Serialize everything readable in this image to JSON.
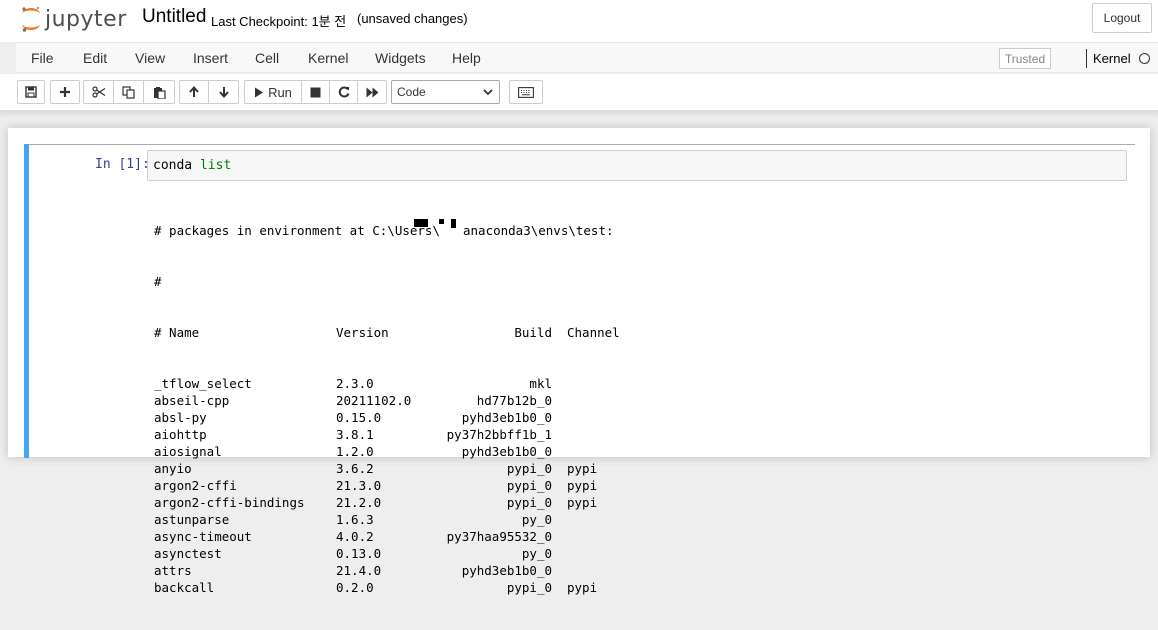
{
  "header": {
    "logo_text": "jupyter",
    "notebook_name": "Untitled",
    "checkpoint": "Last Checkpoint: 1분 전",
    "unsaved": "(unsaved changes)",
    "logout_label": "Logout"
  },
  "menubar": {
    "items": [
      "File",
      "Edit",
      "View",
      "Insert",
      "Cell",
      "Kernel",
      "Widgets",
      "Help"
    ],
    "trusted_label": "Trusted",
    "kernel_label": "Kernel"
  },
  "toolbar": {
    "run_label": "Run",
    "cell_type": "Code"
  },
  "cell": {
    "prompt": "In [1]:",
    "code_cmd": "conda",
    "code_arg": "list",
    "output_header": [
      "# packages in environment at C:\\Users\\",
      "#",
      "# Name"
    ],
    "env_path_suffix": "anaconda3\\envs\\test:",
    "columns": {
      "version": "Version",
      "build": "Build",
      "channel": "Channel"
    },
    "packages": [
      {
        "name": "_tflow_select",
        "version": "2.3.0",
        "build": "mkl",
        "channel": ""
      },
      {
        "name": "abseil-cpp",
        "version": "20211102.0",
        "build": "hd77b12b_0",
        "channel": ""
      },
      {
        "name": "absl-py",
        "version": "0.15.0",
        "build": "pyhd3eb1b0_0",
        "channel": ""
      },
      {
        "name": "aiohttp",
        "version": "3.8.1",
        "build": "py37h2bbff1b_1",
        "channel": ""
      },
      {
        "name": "aiosignal",
        "version": "1.2.0",
        "build": "pyhd3eb1b0_0",
        "channel": ""
      },
      {
        "name": "anyio",
        "version": "3.6.2",
        "build": "pypi_0",
        "channel": "pypi"
      },
      {
        "name": "argon2-cffi",
        "version": "21.3.0",
        "build": "pypi_0",
        "channel": "pypi"
      },
      {
        "name": "argon2-cffi-bindings",
        "version": "21.2.0",
        "build": "pypi_0",
        "channel": "pypi"
      },
      {
        "name": "astunparse",
        "version": "1.6.3",
        "build": "py_0",
        "channel": ""
      },
      {
        "name": "async-timeout",
        "version": "4.0.2",
        "build": "py37haa95532_0",
        "channel": ""
      },
      {
        "name": "asynctest",
        "version": "0.13.0",
        "build": "py_0",
        "channel": ""
      },
      {
        "name": "attrs",
        "version": "21.4.0",
        "build": "pyhd3eb1b0_0",
        "channel": ""
      },
      {
        "name": "backcall",
        "version": "0.2.0",
        "build": "pypi_0",
        "channel": "pypi"
      }
    ]
  }
}
